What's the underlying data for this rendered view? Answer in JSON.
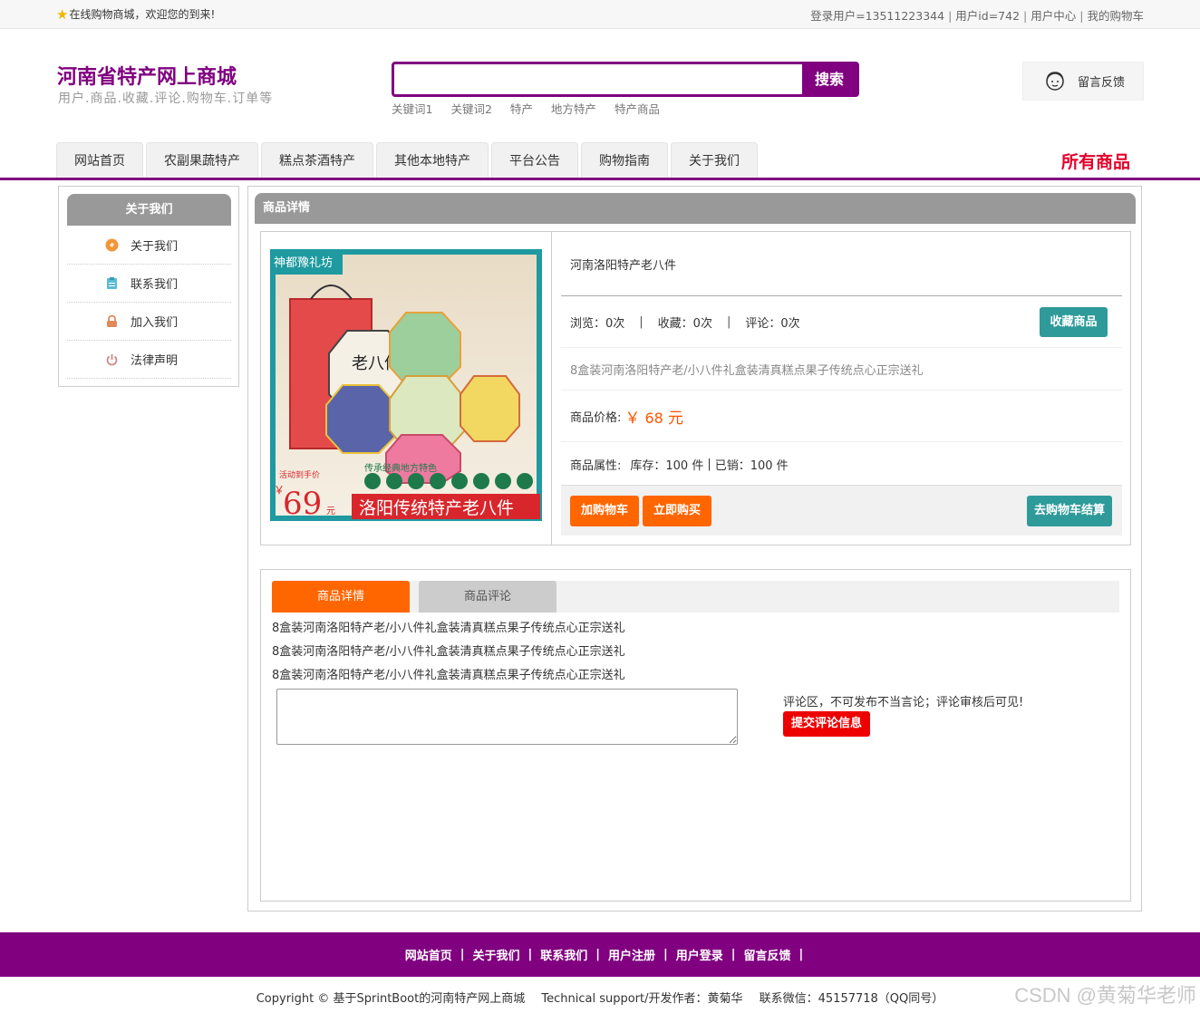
{
  "topbar": {
    "welcome": "在线购物商城，欢迎您的到来!",
    "user_login": "登录用户=13511223344",
    "user_id": "用户id=742",
    "user_center": "用户中心",
    "my_cart": "我的购物车"
  },
  "header": {
    "title": "河南省特产网上商城",
    "subtitle": "用户.商品.收藏.评论.购物车.订单等",
    "search_placeholder": "",
    "search_button": "搜索",
    "keywords": [
      "关键词1",
      "关键词2",
      "特产",
      "地方特产",
      "特产商品"
    ],
    "feedback": "留言反馈"
  },
  "nav": {
    "items": [
      "网站首页",
      "农副果蔬特产",
      "糕点茶酒特产",
      "其他本地特产",
      "平台公告",
      "购物指南",
      "关于我们"
    ],
    "all_goods": "所有商品"
  },
  "sidebar": {
    "title": "关于我们",
    "items": [
      {
        "label": "关于我们",
        "icon": "orange-circle-icon",
        "color": "#f0963a"
      },
      {
        "label": "联系我们",
        "icon": "clipboard-icon",
        "color": "#5bbbd6"
      },
      {
        "label": "加入我们",
        "icon": "lock-icon",
        "color": "#e08a5a"
      },
      {
        "label": "法律声明",
        "icon": "power-icon",
        "color": "#cc8888"
      }
    ]
  },
  "product": {
    "section_title": "商品详情",
    "name": "河南洛阳特产老八件",
    "views_label": "浏览：0次",
    "favorites_label": "收藏：0次",
    "comments_label": "评论：0次",
    "favorite_button": "收藏商品",
    "description": "8盒装河南洛阳特产老/小八件礼盒装清真糕点果子传统点心正宗送礼",
    "price_label": "商品价格:",
    "price_currency": "￥",
    "price_value": "68",
    "price_unit": "元",
    "attr_label": "商品属性:",
    "stock": "库存：100 件",
    "sold": "已销：100 件",
    "add_cart": "加购物车",
    "buy_now": "立即购买",
    "checkout": "去购物车结算",
    "image": {
      "brand": "神都豫礼坊",
      "box_label": "老八件",
      "sub_label": "传承经典地方特色",
      "banner": "洛阳传统特产老八件",
      "promo": "活动到手价",
      "promo_price": "69",
      "promo_unit": "元"
    }
  },
  "tabs": {
    "detail": "商品详情",
    "reviews": "商品评论",
    "lines": [
      "8盒装河南洛阳特产老/小八件礼盒装清真糕点果子传统点心正宗送礼",
      "8盒装河南洛阳特产老/小八件礼盒装清真糕点果子传统点心正宗送礼",
      "8盒装河南洛阳特产老/小八件礼盒装清真糕点果子传统点心正宗送礼"
    ],
    "comment_tip": "评论区，不可发布不当言论；评论审核后可见!",
    "submit": "提交评论信息"
  },
  "footer": {
    "links": [
      "网站首页",
      "关于我们",
      "联系我们",
      "用户注册",
      "用户登录",
      "留言反馈"
    ],
    "copyright": "Copyright © 基于SprintBoot的河南特产网上商城",
    "support": "Technical support/开发作者：黄菊华",
    "contact": "联系微信：45157718（QQ同号）",
    "watermark": "CSDN @黄菊华老师"
  },
  "colors": {
    "brand": "#800080",
    "orange": "#ff6600",
    "teal": "#2f9a9a",
    "red": "#e4002b"
  }
}
